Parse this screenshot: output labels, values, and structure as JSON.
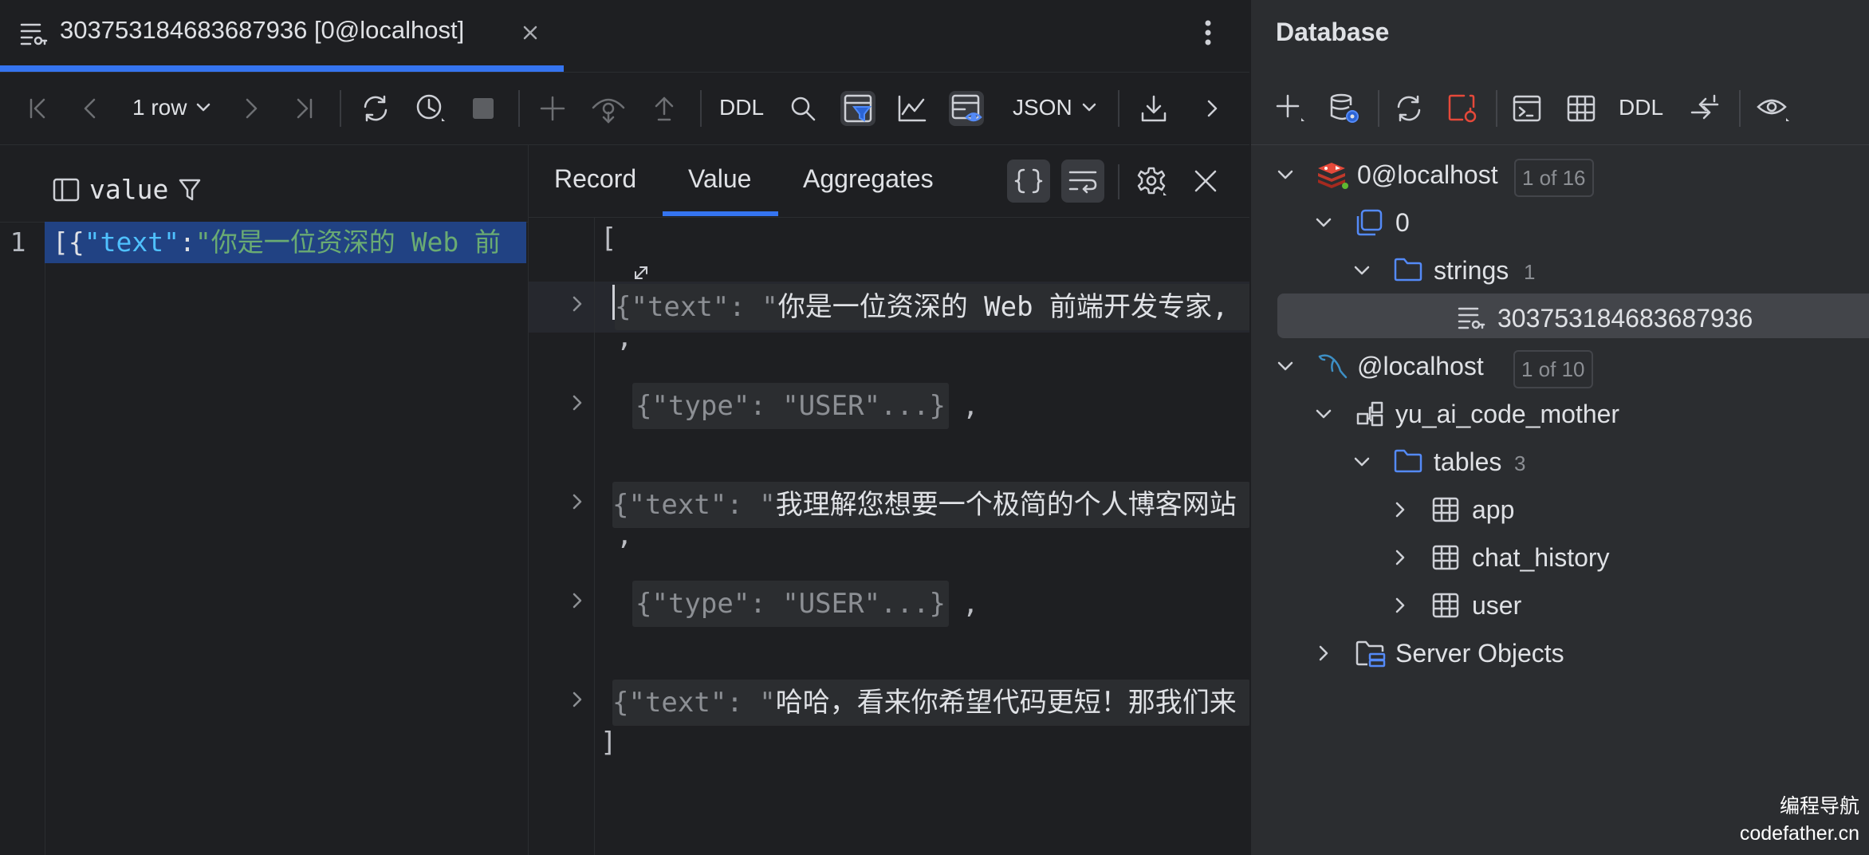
{
  "tab": {
    "title": "303753184683687936 [0@localhost]"
  },
  "toolbar": {
    "row_count": "1 row",
    "ddl": "DDL",
    "format": "JSON"
  },
  "grid": {
    "column_name": "value",
    "row_number": "1",
    "cell_prefix_brace": "[{",
    "cell_key": "\"text\"",
    "cell_colon": ":",
    "cell_value": "\"你是一位资深的 Web 前"
  },
  "value_panel": {
    "tabs": [
      "Record",
      "Value",
      "Aggregates"
    ],
    "active_tab": "Value",
    "lines": {
      "open_bracket": "[",
      "item1_head": "{\"text\": \"",
      "item1_text": "你是一位资深的 Web 前端开发专家,",
      "comma": ",",
      "item2": "{\"type\": \"USER\"...}",
      "item2_comma": ",",
      "item3_head": "{\"text\": \"",
      "item3_text": "我理解您想要一个极简的个人博客网站",
      "item4": "{\"type\": \"USER\"...}",
      "item4_comma": ",",
      "item5_head": "{\"text\": \"",
      "item5_text": "哈哈，看来你希望代码更短！那我们来",
      "close_bracket": "]"
    }
  },
  "database": {
    "title": "Database",
    "toolbar_ddl": "DDL",
    "tree": {
      "redis_conn": {
        "label": "0@localhost",
        "badge": "1 of 16"
      },
      "db0": {
        "label": "0"
      },
      "strings": {
        "label": "strings",
        "count": "1"
      },
      "key": {
        "label": "303753184683687936"
      },
      "mysql_conn": {
        "label": "@localhost",
        "badge": "1 of 10"
      },
      "schema": {
        "label": "yu_ai_code_mother"
      },
      "tables": {
        "label": "tables",
        "count": "3"
      },
      "table_app": {
        "label": "app"
      },
      "table_chat": {
        "label": "chat_history"
      },
      "table_user": {
        "label": "user"
      },
      "server_objects": {
        "label": "Server Objects"
      }
    }
  },
  "watermark": {
    "line1": "编程导航",
    "line2": "codefather.cn"
  },
  "colors": {
    "accent": "#3574f0",
    "selection": "#214283",
    "json_key": "#4fc1ff",
    "json_string": "#6aab73",
    "redis_red": "#e5493a",
    "folder_blue": "#548af7"
  }
}
